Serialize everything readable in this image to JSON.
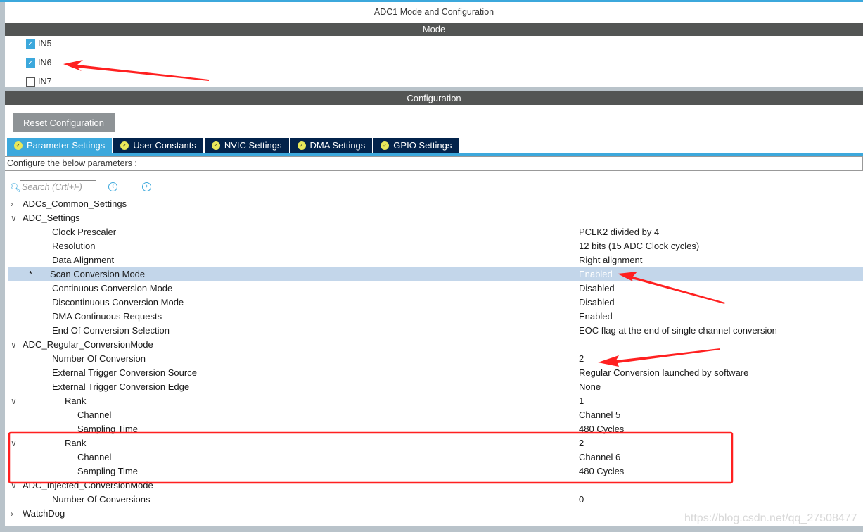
{
  "title": "ADC1 Mode and Configuration",
  "mode_header": "Mode",
  "channels": [
    {
      "label": "IN5",
      "checked": true
    },
    {
      "label": "IN6",
      "checked": true
    },
    {
      "label": "IN7",
      "checked": false
    }
  ],
  "config_header": "Configuration",
  "reset_label": "Reset Configuration",
  "tabs": [
    {
      "label": "Parameter Settings",
      "active": true
    },
    {
      "label": "User Constants"
    },
    {
      "label": "NVIC Settings"
    },
    {
      "label": "DMA Settings"
    },
    {
      "label": "GPIO Settings"
    }
  ],
  "configure_text": "Configure the below parameters :",
  "search_placeholder": "Search (Crtl+F)",
  "rows": [
    {
      "label": "ADCs_Common_Settings",
      "value": "",
      "level": 0,
      "chev": ">"
    },
    {
      "label": "ADC_Settings",
      "value": "",
      "level": 0,
      "chev": "v"
    },
    {
      "label": "Clock Prescaler",
      "value": "PCLK2 divided by 4",
      "level": 1
    },
    {
      "label": "Resolution",
      "value": "12 bits (15 ADC Clock cycles)",
      "level": 1
    },
    {
      "label": "Data Alignment",
      "value": "Right alignment",
      "level": 1
    },
    {
      "label": "Scan Conversion Mode",
      "value": "Enabled",
      "level": 1,
      "selected": true,
      "mark": "*"
    },
    {
      "label": "Continuous Conversion Mode",
      "value": "Disabled",
      "level": 1
    },
    {
      "label": "Discontinuous Conversion Mode",
      "value": "Disabled",
      "level": 1
    },
    {
      "label": "DMA Continuous Requests",
      "value": "Enabled",
      "level": 1
    },
    {
      "label": "End Of Conversion Selection",
      "value": "EOC flag at the end of single channel conversion",
      "level": 1
    },
    {
      "label": "ADC_Regular_ConversionMode",
      "value": "",
      "level": 0,
      "chev": "v"
    },
    {
      "label": "Number Of Conversion",
      "value": "2",
      "level": 1
    },
    {
      "label": "External Trigger Conversion Source",
      "value": "Regular Conversion launched by software",
      "level": 1
    },
    {
      "label": "External Trigger Conversion Edge",
      "value": "None",
      "level": 1
    },
    {
      "label": "Rank",
      "value": "1",
      "level": 2,
      "chev": "v"
    },
    {
      "label": "Channel",
      "value": "Channel 5",
      "level": 3
    },
    {
      "label": "Sampling Time",
      "value": "480 Cycles",
      "level": 3
    },
    {
      "label": "Rank",
      "value": "2",
      "level": 2,
      "chev": "v"
    },
    {
      "label": "Channel",
      "value": "Channel 6",
      "level": 3
    },
    {
      "label": "Sampling Time",
      "value": "480 Cycles",
      "level": 3
    },
    {
      "label": "ADC_Injected_ConversionMode",
      "value": "",
      "level": 0,
      "chev": "v"
    },
    {
      "label": "Number Of Conversions",
      "value": "0",
      "level": 1
    },
    {
      "label": "WatchDog",
      "value": "",
      "level": 0,
      "chev": ">"
    }
  ],
  "watermark": "https://blog.csdn.net/qq_27508477",
  "colors": {
    "accent": "#3ca8dc",
    "tab_bg": "#03234b",
    "header_bg": "#535554",
    "annotation": "#ff2020"
  }
}
